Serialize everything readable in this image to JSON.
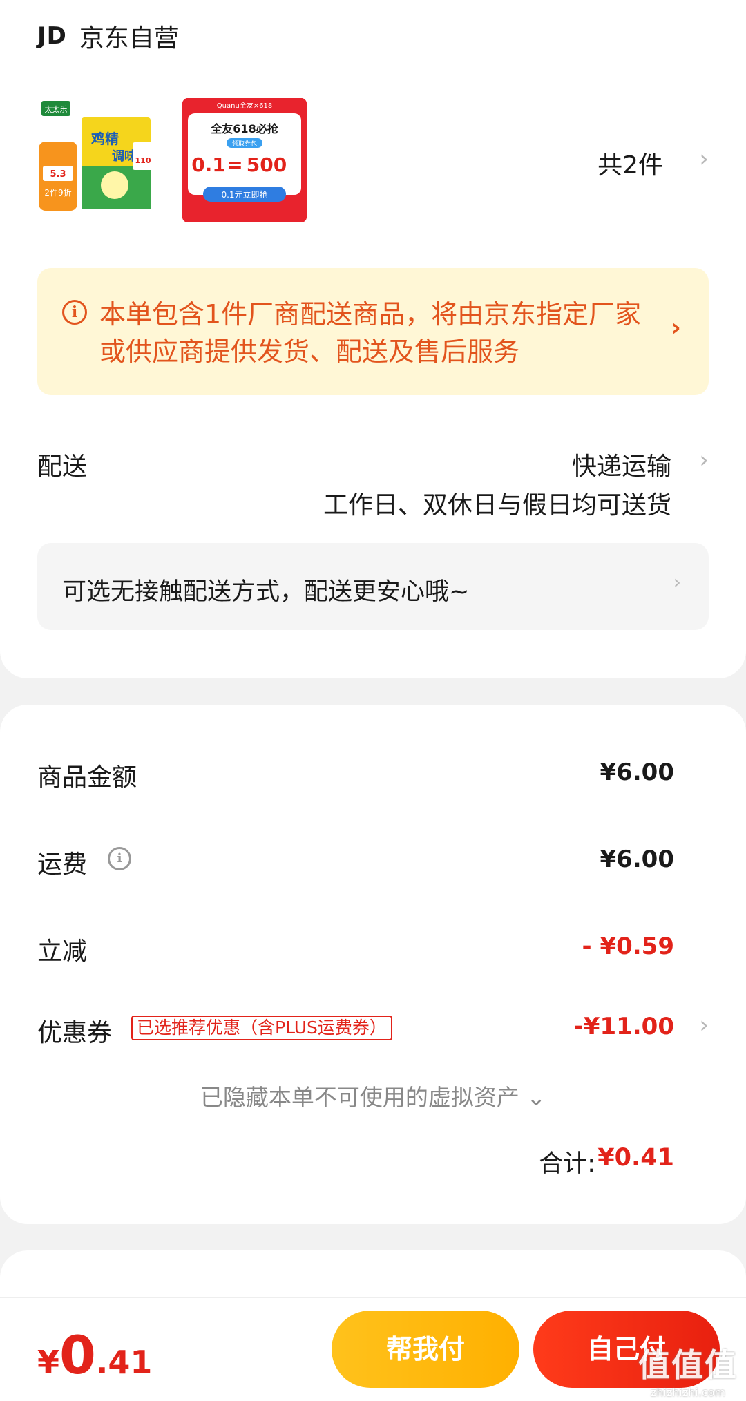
{
  "store": {
    "logo": "JD",
    "name": "京东自营"
  },
  "products": {
    "item1": {
      "brand": "太太乐",
      "badge": "2件9折",
      "price": "5.3",
      "pack_title": "鸡精",
      "pack_sub": "调味",
      "pack_price": "110"
    },
    "item2": {
      "top_text": "Quanu全友×618",
      "headline": "全友618必抢",
      "tag": "领取券包",
      "left_num": "0.1",
      "eq": "=",
      "right_num": "500",
      "cta": "0.1元立即抢"
    },
    "count": "共2件"
  },
  "notice": {
    "icon": "info-icon",
    "text": "本单包含1件厂商配送商品，将由京东指定厂家或供应商提供发货、配送及售后服务"
  },
  "delivery": {
    "label": "配送",
    "method": "快递运输",
    "schedule": "工作日、双休日与假日均可送货",
    "contactless": "可选无接触配送方式，配送更安心哦~"
  },
  "fees": {
    "goods_label": "商品金额",
    "goods_value": "¥6.00",
    "shipping_label": "运费",
    "shipping_value": "¥6.00",
    "discount_label": "立减",
    "discount_value": "- ¥0.59",
    "coupon_label": "优惠券",
    "coupon_tag": "已选推荐优惠（含PLUS运费券）",
    "coupon_value": "-¥11.00",
    "hidden_assets": "已隐藏本单不可使用的虚拟资产",
    "total_label": "合计:",
    "total_value": "¥0.41"
  },
  "bottom": {
    "yen": "¥",
    "int": "0",
    "dec": ".41",
    "help_pay": "帮我付",
    "self_pay": "自己付"
  },
  "watermark": {
    "glyphs": "值值值",
    "url": "zhizhizhi.com"
  },
  "colors": {
    "accent_red": "#e2231a",
    "notice_bg": "#fff7d6",
    "notice_text": "#e2541d",
    "help_btn": "#ffb000"
  }
}
